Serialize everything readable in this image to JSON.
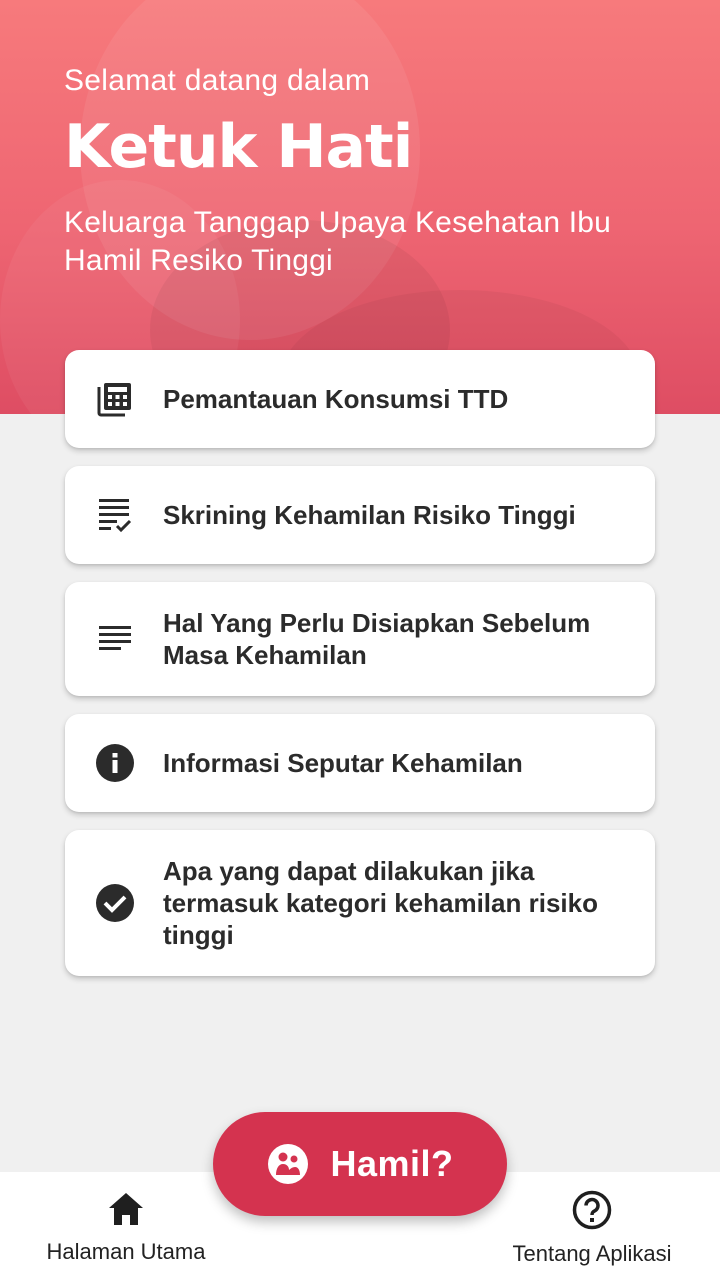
{
  "hero": {
    "greeting": "Selamat datang dalam",
    "title": "Ketuk Hati",
    "subtitle": "Keluarga Tanggap Upaya Kesehatan Ibu Hamil Resiko Tinggi"
  },
  "menu": {
    "items": [
      {
        "label": "Pemantauan Konsumsi TTD",
        "icon": "calculator-stack-icon"
      },
      {
        "label": "Skrining Kehamilan Risiko Tinggi",
        "icon": "checklist-icon"
      },
      {
        "label": "Hal Yang Perlu Disiapkan Sebelum Masa Kehamilan",
        "icon": "text-lines-icon"
      },
      {
        "label": "Informasi Seputar Kehamilan",
        "icon": "info-icon"
      },
      {
        "label": "Apa yang dapat dilakukan jika termasuk kategori kehamilan risiko tinggi",
        "icon": "check-circle-icon"
      }
    ]
  },
  "fab": {
    "label": "Hamil?",
    "icon": "pregnant-woman-icon"
  },
  "bottom_nav": {
    "home_label": "Halaman Utama",
    "about_label": "Tentang Aplikasi"
  },
  "colors": {
    "hero_top": "#f77a7c",
    "hero_bottom": "#de4d63",
    "fab": "#d4334f",
    "background": "#f0f0f0",
    "card": "#ffffff",
    "text_dark": "#2b2b2b"
  }
}
